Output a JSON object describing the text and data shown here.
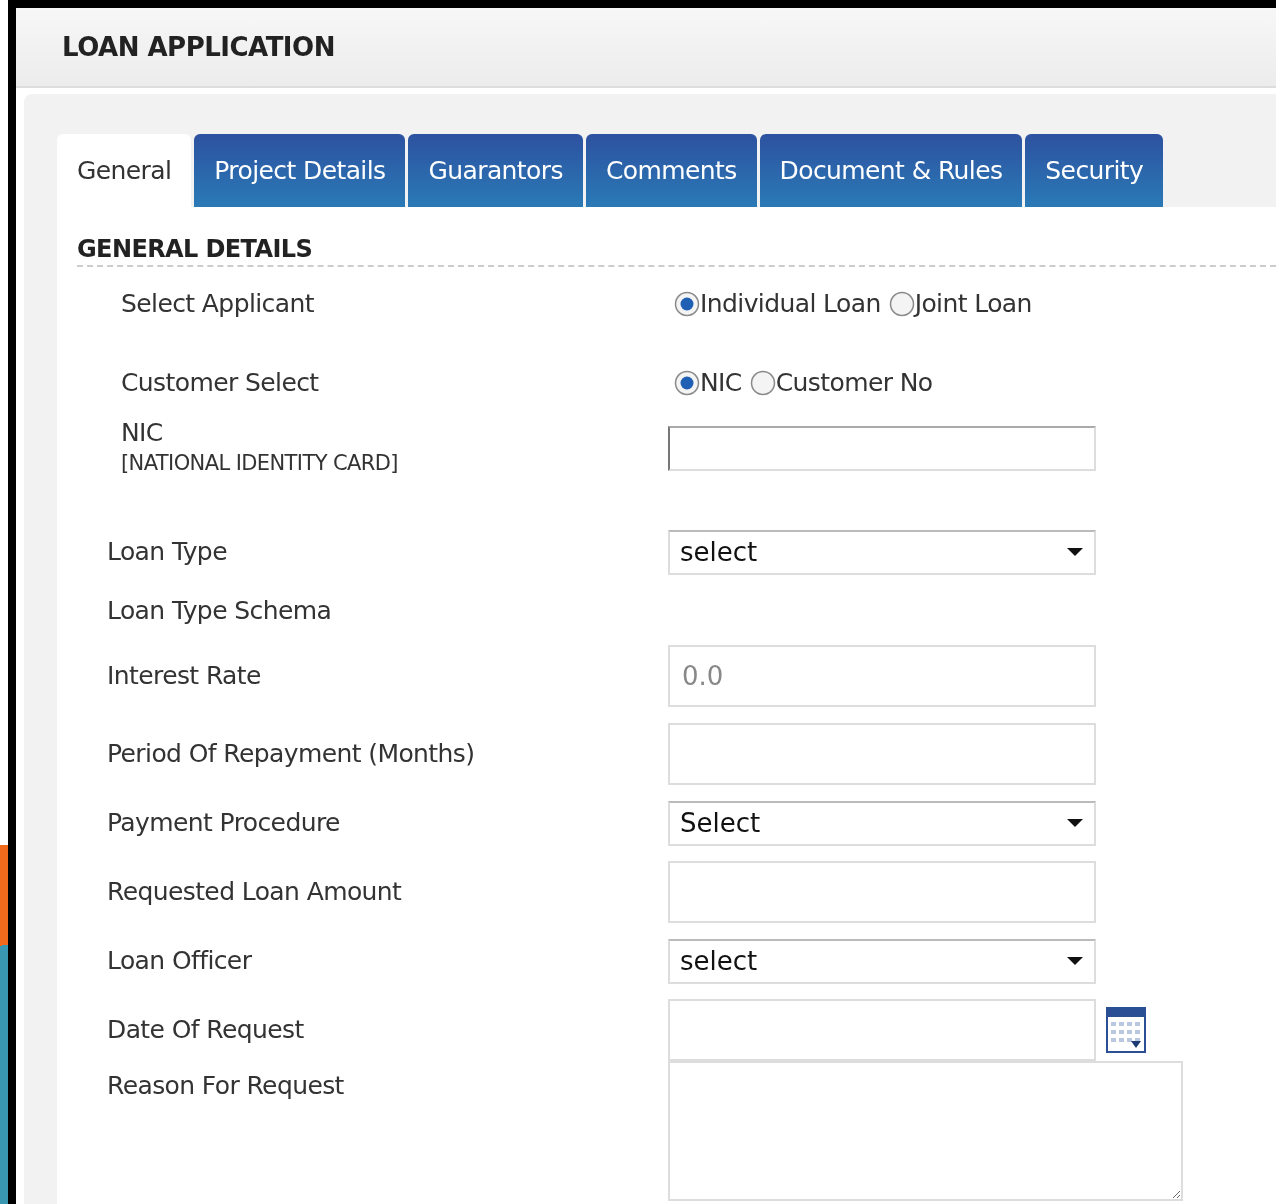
{
  "title": "LOAN APPLICATION",
  "tabs": [
    {
      "label": "General",
      "selected": true
    },
    {
      "label": "Project Details",
      "selected": false
    },
    {
      "label": "Guarantors",
      "selected": false
    },
    {
      "label": "Comments",
      "selected": false
    },
    {
      "label": "Document & Rules",
      "selected": false
    },
    {
      "label": "Security",
      "selected": false
    }
  ],
  "section_title": "GENERAL DETAILS",
  "fields": [
    {
      "kind": "radio",
      "label": "Select Applicant",
      "options": [
        {
          "label": "Individual Loan",
          "selected": true
        },
        {
          "label": "Joint Loan",
          "selected": false
        }
      ]
    },
    {
      "kind": "radio",
      "label": "Customer Select",
      "options": [
        {
          "label": "NIC",
          "selected": true
        },
        {
          "label": "Customer No",
          "selected": false
        }
      ]
    },
    {
      "kind": "text",
      "label": "NIC",
      "sublabel": "[NATIONAL IDENTITY CARD]"
    },
    {
      "kind": "select",
      "label": "Loan Type",
      "value": "select"
    },
    {
      "kind": "plain",
      "label": "Loan Type Schema"
    },
    {
      "kind": "text",
      "label": "Interest Rate",
      "value": "0.0"
    },
    {
      "kind": "text",
      "label": "Period Of Repayment (Months)"
    },
    {
      "kind": "select",
      "label": "Payment Procedure",
      "value": "Select"
    },
    {
      "kind": "text",
      "label": "Requested Loan Amount"
    },
    {
      "kind": "select",
      "label": "Loan Officer",
      "value": "select"
    },
    {
      "kind": "date",
      "label": "Date Of Request"
    },
    {
      "kind": "textarea",
      "label": "Reason For Request"
    }
  ]
}
